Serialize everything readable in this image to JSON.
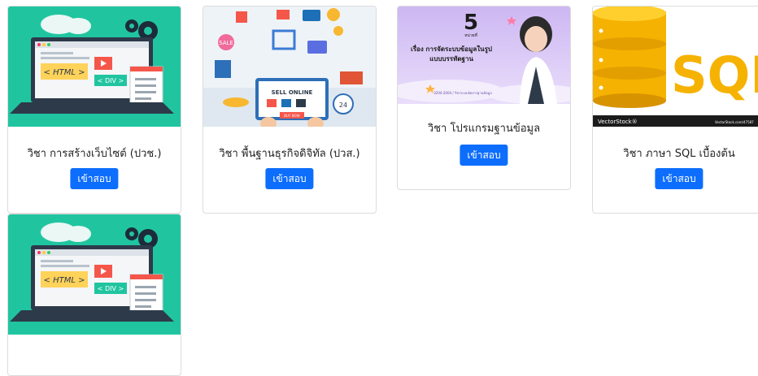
{
  "courses": [
    {
      "title": "วิชา การสร้างเว็บไซต์ (ปวช.)",
      "button": "เข้าสอบ",
      "image": {
        "html_tag": "< HTML >",
        "div_tag": "< DIV >"
      }
    },
    {
      "title": "วิชา พื้นฐานธุรกิจดิจิทัล (ปวส.)",
      "button": "เข้าสอบ",
      "image": {
        "banner": "SELL ONLINE",
        "sale": "SALE",
        "buy": "BUY NOW",
        "clock": "24"
      }
    },
    {
      "title": "วิชา โปรแกรมฐานข้อมูล",
      "button": "เข้าสอบ",
      "image": {
        "unit_number": "5",
        "unit_label": "หน่วยที่",
        "headline_1": "เรื่อง การจัดระบบข้อมูลในรูป",
        "headline_2": "แบบบรรทัดฐาน",
        "course_code": "3204-2004 / วิชาระบบจัดการฐานข้อมูล"
      }
    },
    {
      "title": "วิชา ภาษา SQL เบื้องต้น",
      "button": "เข้าสอบ",
      "image": {
        "word": "SQL",
        "watermark": "VectorStock®",
        "watermark_url": "VectorStock.com/47587"
      }
    },
    {
      "title": "",
      "button": "",
      "image": {
        "html_tag": "< HTML >",
        "div_tag": "< DIV >"
      }
    }
  ]
}
